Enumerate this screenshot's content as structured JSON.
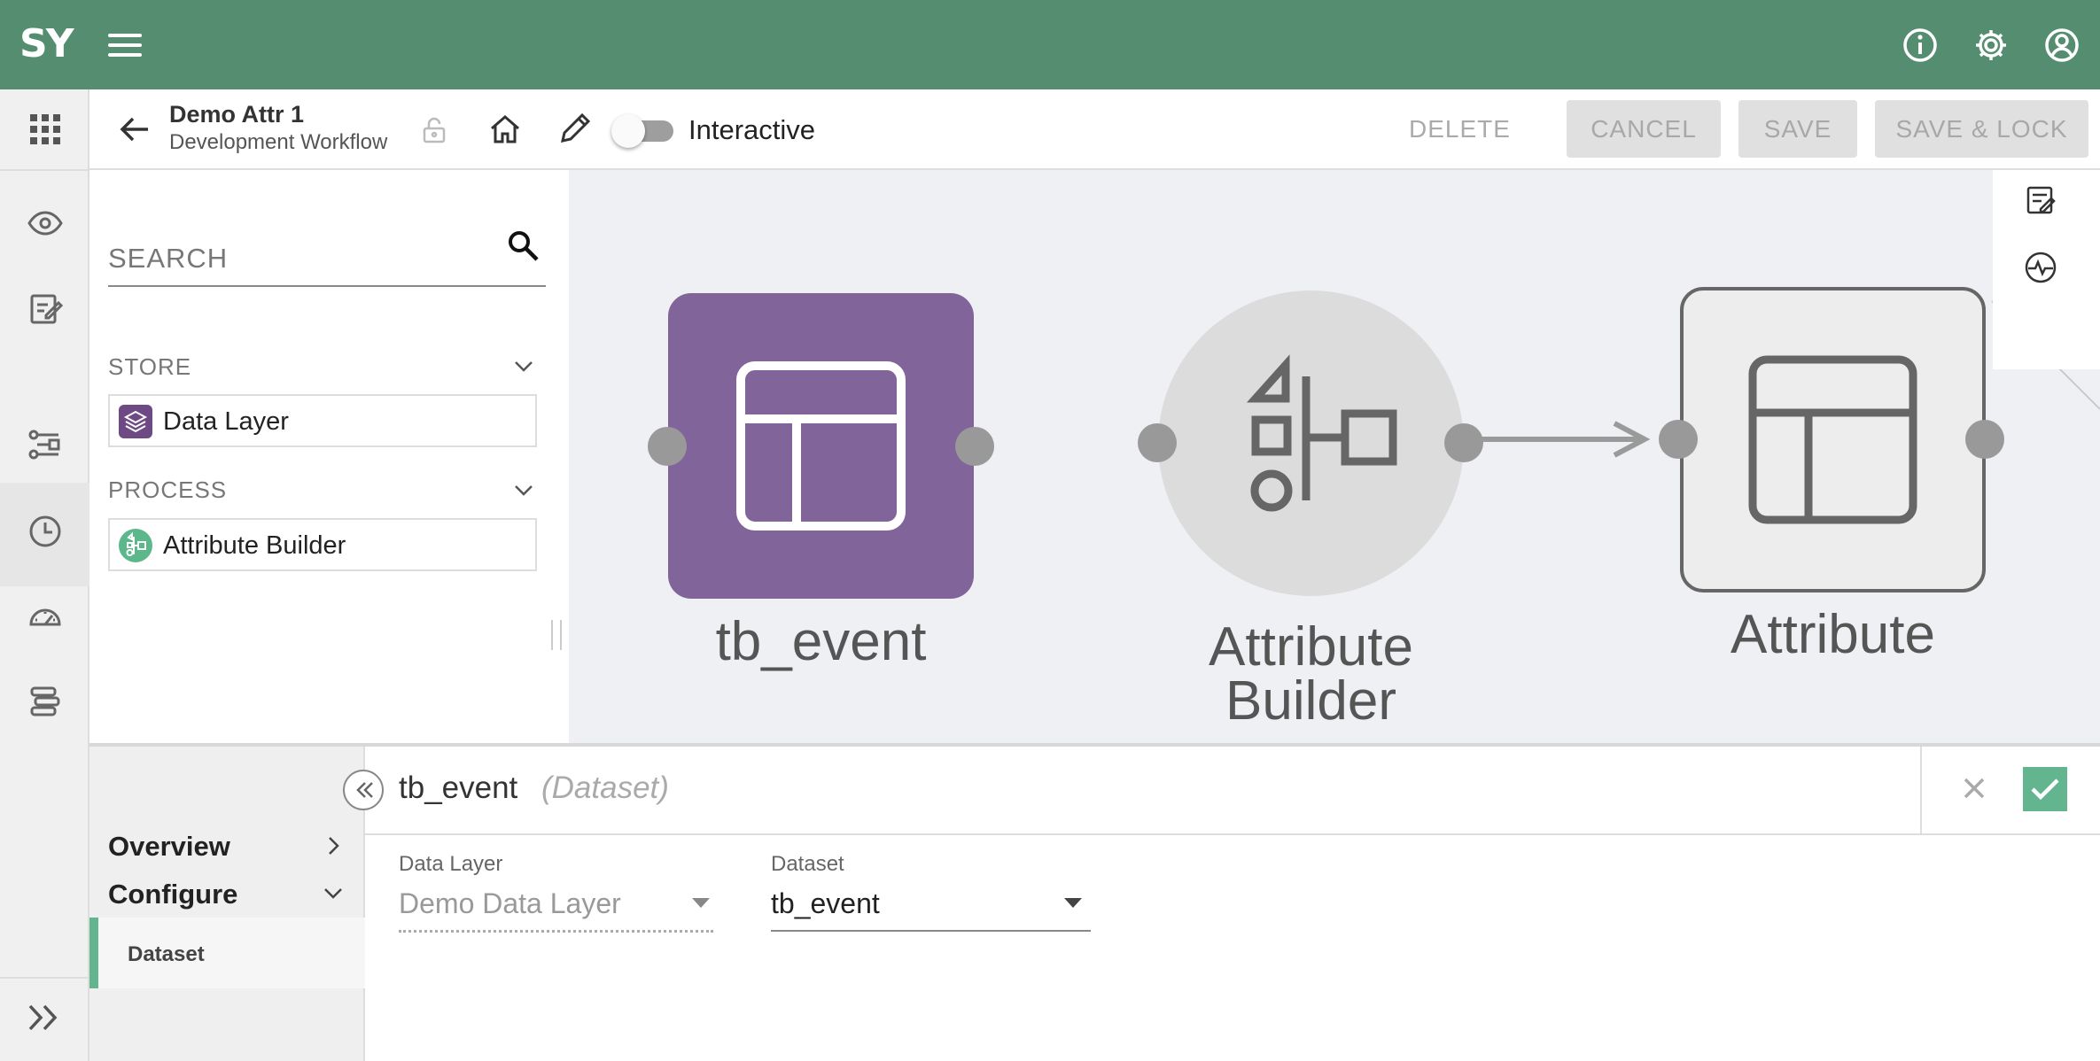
{
  "app": {
    "logo": "SY"
  },
  "header": {
    "icons": [
      "menu-icon",
      "info-icon",
      "settings-icon",
      "account-icon"
    ]
  },
  "workflow": {
    "title": "Demo Attr 1",
    "subtitle": "Development Workflow",
    "interactive_label": "Interactive",
    "interactive_on": false
  },
  "actions": {
    "delete": "DELETE",
    "cancel": "CANCEL",
    "save": "SAVE",
    "save_lock": "SAVE & LOCK"
  },
  "palette": {
    "search_placeholder": "SEARCH",
    "sections": [
      {
        "title": "STORE",
        "items": [
          {
            "label": "Data Layer",
            "icon": "layers-icon",
            "color": "#6e4a85"
          }
        ]
      },
      {
        "title": "PROCESS",
        "items": [
          {
            "label": "Attribute Builder",
            "icon": "builder-icon",
            "color": "#5cb88a"
          }
        ]
      }
    ]
  },
  "canvas": {
    "nodes": [
      {
        "label": "tb_event",
        "type": "dataset",
        "color": "#81649a"
      },
      {
        "label": "Attribute Builder",
        "label_line1": "Attribute",
        "label_line2": "Builder",
        "type": "process",
        "color": "#dcdcdc"
      },
      {
        "label": "Attribute",
        "type": "output",
        "color": "#ededed"
      }
    ]
  },
  "details": {
    "nav": {
      "overview": "Overview",
      "configure": "Configure",
      "dataset": "Dataset"
    },
    "name": "tb_event",
    "type": "(Dataset)",
    "fields": {
      "data_layer": {
        "label": "Data Layer",
        "value": "Demo Data Layer"
      },
      "dataset": {
        "label": "Dataset",
        "value": "tb_event"
      }
    }
  },
  "colors": {
    "header": "#548d6f",
    "accent": "#62b58f",
    "dataset_node": "#81649a"
  }
}
